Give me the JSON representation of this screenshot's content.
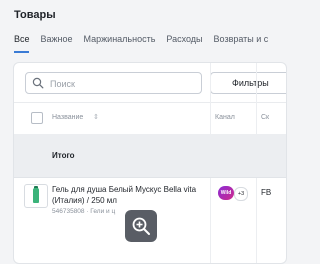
{
  "page": {
    "title": "Товары"
  },
  "tabs": [
    "Все",
    "Важное",
    "Маржинальность",
    "Расходы",
    "Возвраты и с"
  ],
  "toolbar": {
    "search_placeholder": "Поиск",
    "filters_label": "Фильтры",
    "search_icon": "search-icon"
  },
  "table": {
    "headers": {
      "name": "Название",
      "sort_glyph": "⇕",
      "channels": "Канал",
      "next": "Ск"
    },
    "total_label": "Итого",
    "rows": [
      {
        "name": "Гель для душа Белый Мускус Bella vita (Италия) / 250 мл",
        "meta": "546735808 · Гели и ц",
        "channel_logo_text": "Wild",
        "channel_more": "+3",
        "next_col": "FB"
      }
    ]
  },
  "overlay": {
    "zoom_icon": "zoom-in-icon"
  },
  "colors": {
    "accent": "#3a7bd5",
    "background": "#f3f4f6",
    "total_row": "#eceef1",
    "channel_brand": "#8a2bd6"
  }
}
